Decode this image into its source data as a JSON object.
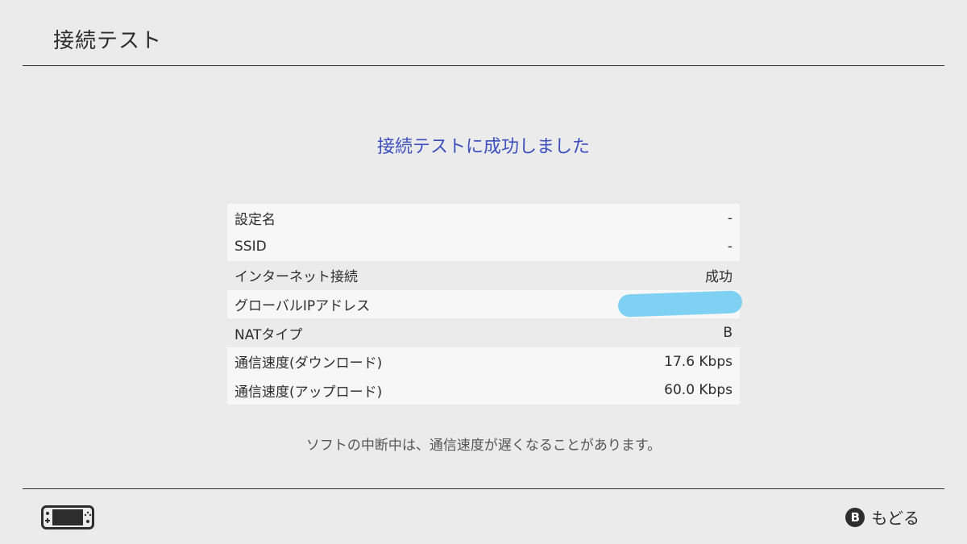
{
  "header": {
    "title": "接続テスト"
  },
  "result": {
    "message": "接続テストに成功しました"
  },
  "rows": [
    {
      "label": "設定名",
      "value": "-"
    },
    {
      "label": "SSID",
      "value": "-"
    },
    {
      "label": "インターネット接続",
      "value": "成功"
    },
    {
      "label": "グローバルIPアドレス",
      "value": ""
    },
    {
      "label": "NATタイプ",
      "value": "B"
    },
    {
      "label": "通信速度(ダウンロード)",
      "value": "17.6 Kbps"
    },
    {
      "label": "通信速度(アップロード)",
      "value": "60.0 Kbps"
    }
  ],
  "note": "ソフトの中断中は、通信速度が遅くなることがあります。",
  "footer": {
    "console_icon": "handheld-console-icon",
    "back_button_glyph": "B",
    "back_label": "もどる"
  },
  "colors": {
    "accent": "#3b4fbf",
    "redaction": "#7fd1f4",
    "background": "#ebebeb"
  }
}
